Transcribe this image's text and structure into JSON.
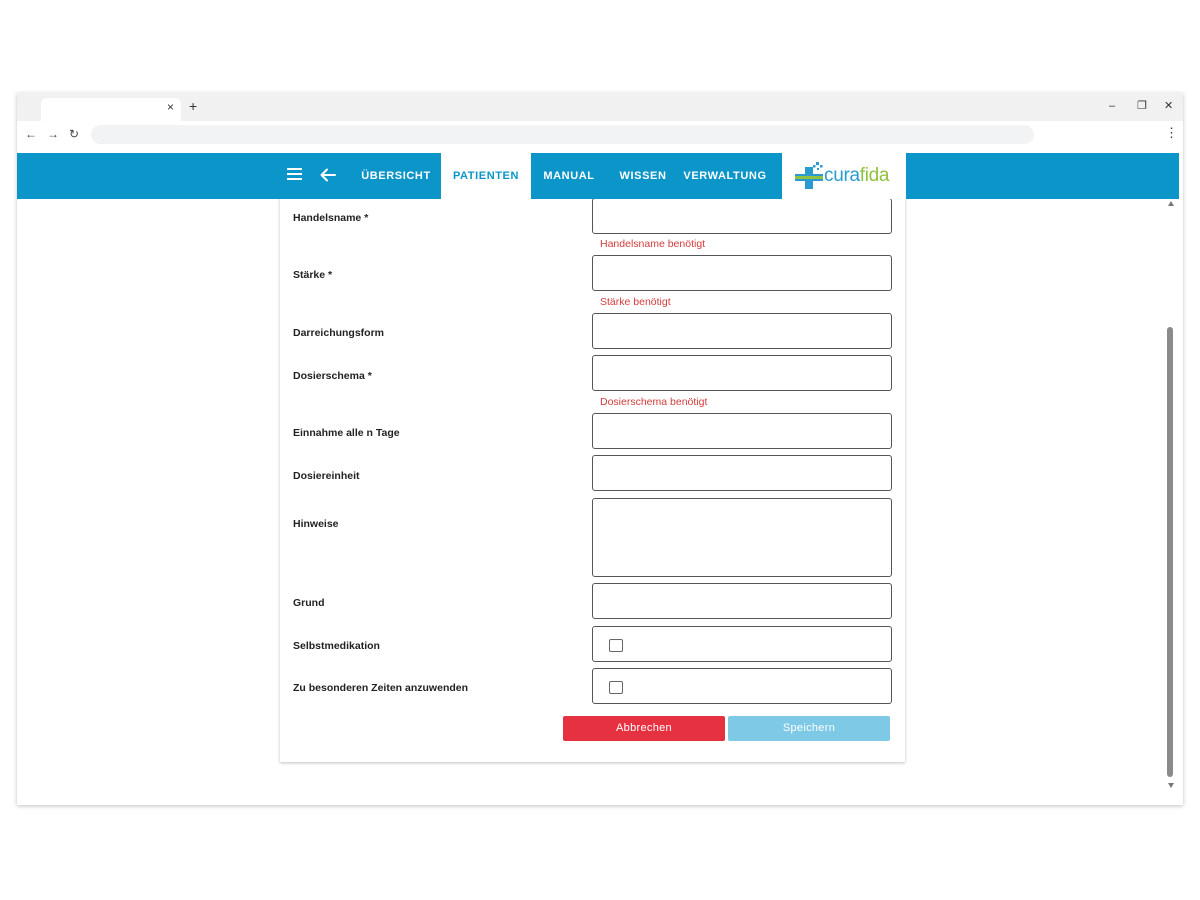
{
  "browser": {
    "tab_close": "×",
    "new_tab": "+",
    "minimize": "–",
    "restore": "❐",
    "close": "✕",
    "back": "←",
    "forward": "→",
    "reload": "↻",
    "menu": "⋮"
  },
  "nav": {
    "items": [
      "ÜBERSICHT",
      "PATIENTEN",
      "MANUAL",
      "WISSEN",
      "VERWALTUNG"
    ],
    "active": "PATIENTEN",
    "accent_color": "#0b95c8"
  },
  "logo": {
    "part1": "cura",
    "part2": "fida"
  },
  "form": {
    "fields": [
      {
        "label": "Handelsname *",
        "error": "Handelsname benötigt"
      },
      {
        "label": "Stärke *",
        "error": "Stärke benötigt"
      },
      {
        "label": "Darreichungsform"
      },
      {
        "label": "Dosierschema *",
        "error": "Dosierschema benötigt"
      },
      {
        "label": "Einnahme alle n Tage"
      },
      {
        "label": "Dosiereinheit"
      },
      {
        "label": "Hinweise"
      },
      {
        "label": "Grund"
      },
      {
        "label": "Selbstmedikation"
      },
      {
        "label": "Zu besonderen Zeiten anzuwenden"
      }
    ],
    "cancel_label": "Abbrechen",
    "save_label": "Speichern",
    "error_color": "#d63b3b"
  }
}
